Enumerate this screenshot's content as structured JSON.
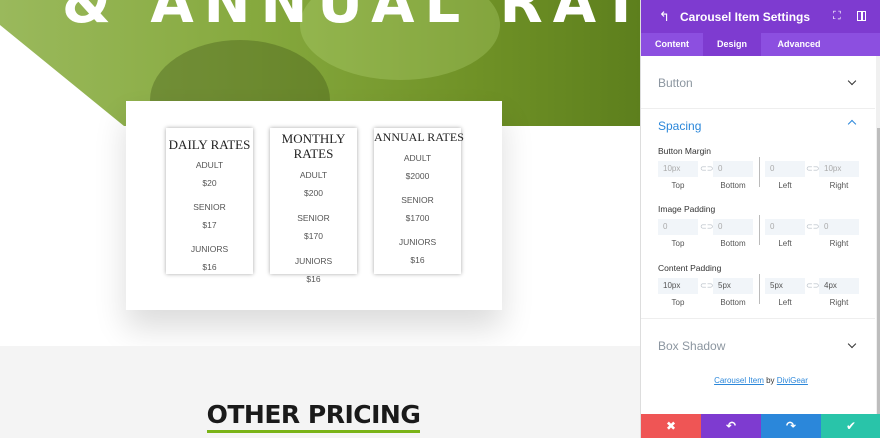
{
  "hero": {
    "title": "& ANNUAL RATES"
  },
  "rates": [
    {
      "title": "DAILY RATES",
      "items": [
        {
          "label": "ADULT",
          "value": "$20"
        },
        {
          "label": "SENIOR",
          "value": "$17"
        },
        {
          "label": "JUNIORS",
          "value": "$16"
        }
      ]
    },
    {
      "title": "MONTHLY RATES",
      "items": [
        {
          "label": "ADULT",
          "value": "$200"
        },
        {
          "label": "SENIOR",
          "value": "$170"
        },
        {
          "label": "JUNIORS",
          "value": "$16"
        }
      ]
    },
    {
      "title": "ANNUAL RATES",
      "items": [
        {
          "label": "ADULT",
          "value": "$2000"
        },
        {
          "label": "SENIOR",
          "value": "$1700"
        },
        {
          "label": "JUNIORS",
          "value": "$16"
        }
      ]
    }
  ],
  "other": {
    "title": "OTHER PRICING"
  },
  "panel": {
    "title": "Carousel Item Settings",
    "tabs": {
      "content": "Content",
      "design": "Design",
      "advanced": "Advanced"
    },
    "active_tab": "Design",
    "sections": {
      "button": "Button",
      "spacing": "Spacing",
      "box_shadow": "Box Shadow"
    },
    "groups": [
      {
        "label": "Button Margin",
        "values": [
          "10px",
          "0",
          "0",
          "10px"
        ]
      },
      {
        "label": "Image Padding",
        "values": [
          "0",
          "0",
          "0",
          "0"
        ]
      },
      {
        "label": "Content Padding",
        "values": [
          "10px",
          "5px",
          "5px",
          "4px"
        ]
      }
    ],
    "sublabels": {
      "top": "Top",
      "bottom": "Bottom",
      "left": "Left",
      "right": "Right"
    },
    "credit": {
      "module": "Carousel Item",
      "by": "by",
      "author": "DiviGear"
    },
    "footer": {
      "cancel": "✖",
      "undo": "↶",
      "redo": "↷",
      "save": "✔"
    }
  },
  "colors": {
    "accent_purple": "#7e3bd0",
    "accent_blue": "#2b87da",
    "cancel_red": "#ef5555",
    "save_green": "#29c4a9",
    "underline_green": "#7ab317"
  }
}
